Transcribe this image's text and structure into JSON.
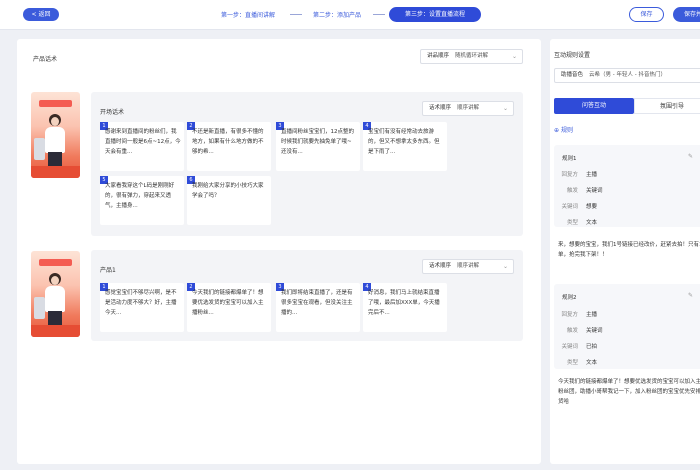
{
  "topbar": {
    "back_label": "< 返回",
    "step1": "第一步：直播间讲解",
    "step2": "第二步：添加产品",
    "step3": "第三步：设置直播流程",
    "save": "保存",
    "save_next": "保存并"
  },
  "main": {
    "title": "产品话术",
    "order_select": {
      "label": "讲品顺序",
      "value": "随机循环讲解"
    },
    "sections": [
      {
        "title": "开场话术",
        "order_select": {
          "label": "话术顺序",
          "value": "顺序讲解"
        },
        "cards": [
          {
            "num": "1",
            "text": "感谢来到直播间的粉丝们，我直播时间一般是6点~12点，今天会有重..."
          },
          {
            "num": "2",
            "text": "不还是新直播，有很多不懂的地方，如果有什么地方做的不够的希..."
          },
          {
            "num": "3",
            "text": "直播间粉丝宝宝们，12点整的时候我们就要先抽免单了哦~还没有..."
          },
          {
            "num": "4",
            "text": "宝宝们有没有经常动去旅游的，但又不想拿太多东西。但是下雨了..."
          },
          {
            "num": "5",
            "text": "大家看我穿这个L码是刚刚好的，很有弹力，穿起来又透气，主播身..."
          },
          {
            "num": "6",
            "text": "我刚给大家分享的小技巧大家学会了吗？"
          }
        ]
      },
      {
        "title": "产品1",
        "order_select": {
          "label": "话术顺序",
          "value": "顺序讲解"
        },
        "cards": [
          {
            "num": "1",
            "text": "感觉宝宝们不够尽兴啊，是不是活动力度不够大？好，主播今天..."
          },
          {
            "num": "2",
            "text": "今天我们的链接都爆单了！想要优选发货的宝宝可以加入主播粉丝..."
          },
          {
            "num": "3",
            "text": "我们即将结束直播了，还是有很多宝宝在观看，但没关注主播的..."
          },
          {
            "num": "4",
            "text": "好消息，我们马上就结束直播了哦，最后加XXX单，今天播完后不..."
          }
        ]
      }
    ]
  },
  "side": {
    "title": "互动规则设置",
    "voice_select": {
      "label": "助播音色",
      "value": "云希（男 - 年轻人 - 抖音热门）"
    },
    "tabs": {
      "active": "问答互动",
      "other": "氛围引导"
    },
    "add_rule": "规则",
    "rules": [
      {
        "title": "规则1",
        "rows": [
          {
            "k": "回复方",
            "v": "主播"
          },
          {
            "k": "触发",
            "v": "关键词"
          },
          {
            "k": "关键词",
            "v": "想要"
          },
          {
            "k": "类型",
            "v": "文本"
          }
        ],
        "reply": "来，想要的宝宝，我们1号链接已经改价，赶紧去拍！只有10单，抢完我下架！！"
      },
      {
        "title": "规则2",
        "rows": [
          {
            "k": "回复方",
            "v": "主播"
          },
          {
            "k": "触发",
            "v": "关键词"
          },
          {
            "k": "关键词",
            "v": "已拍"
          },
          {
            "k": "类型",
            "v": "文本"
          }
        ],
        "reply": "今天我们的链接都爆单了！想要优选发货的宝宝可以加入主播粉丝团，助播小哥帮我记一下，加入粉丝团的宝宝优先安排发货哈"
      }
    ]
  }
}
